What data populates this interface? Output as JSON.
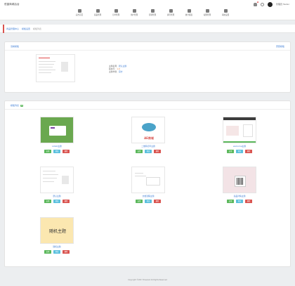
{
  "brand": "低窗商城后台",
  "nav": [
    {
      "label": "后台首页",
      "icon": "home-icon"
    },
    {
      "label": "商品管理",
      "icon": "box-icon"
    },
    {
      "label": "订单管理",
      "icon": "chart-icon"
    },
    {
      "label": "用户管理",
      "icon": "list-icon"
    },
    {
      "label": "营销管理",
      "icon": "grid-icon"
    },
    {
      "label": "资讯管理",
      "icon": "shield-icon"
    },
    {
      "label": "统计报表",
      "icon": "clock-icon"
    },
    {
      "label": "权限管理",
      "icon": "users-icon"
    },
    {
      "label": "系统设置",
      "icon": "gear-icon"
    }
  ],
  "user": {
    "name": "管理员 Tester",
    "notification_count": "1"
  },
  "breadcrumb": [
    "商品管理中心",
    "模板设置",
    "模板列表"
  ],
  "current_panel": {
    "title": "当前模板",
    "action": "安装模板",
    "info": {
      "name": "主题名称：",
      "name_value": "默认主题",
      "version": "版本号：",
      "version_value": "1.0",
      "author": "主题作者：",
      "author_value": "官方"
    }
  },
  "list_panel": {
    "title": "模板列表",
    "count": "8"
  },
  "themes": [
    {
      "name": "LOGO主题",
      "thumb": "green"
    },
    {
      "name": "二维码打印主题",
      "thumb": "flower"
    },
    {
      "name": "welcome主题",
      "thumb": "welcome"
    },
    {
      "name": "默认主题",
      "thumb": "plain"
    },
    {
      "name": "文档流程主题",
      "thumb": "doc"
    },
    {
      "name": "商品详情主题",
      "thumb": "qr"
    },
    {
      "name": "随机主题",
      "thumb": "random"
    }
  ],
  "thumb_texts": {
    "flower": "AE商城",
    "random": "随机主题"
  },
  "buttons": {
    "enable": "启用",
    "preview": "预览",
    "delete": "删除"
  },
  "footer": "Copyright ©2017 Powered All Rights Reserved",
  "colors": {
    "accent": "#3a7bd5",
    "success": "#5cb85c",
    "info": "#5bc0de",
    "danger": "#d9534f"
  }
}
